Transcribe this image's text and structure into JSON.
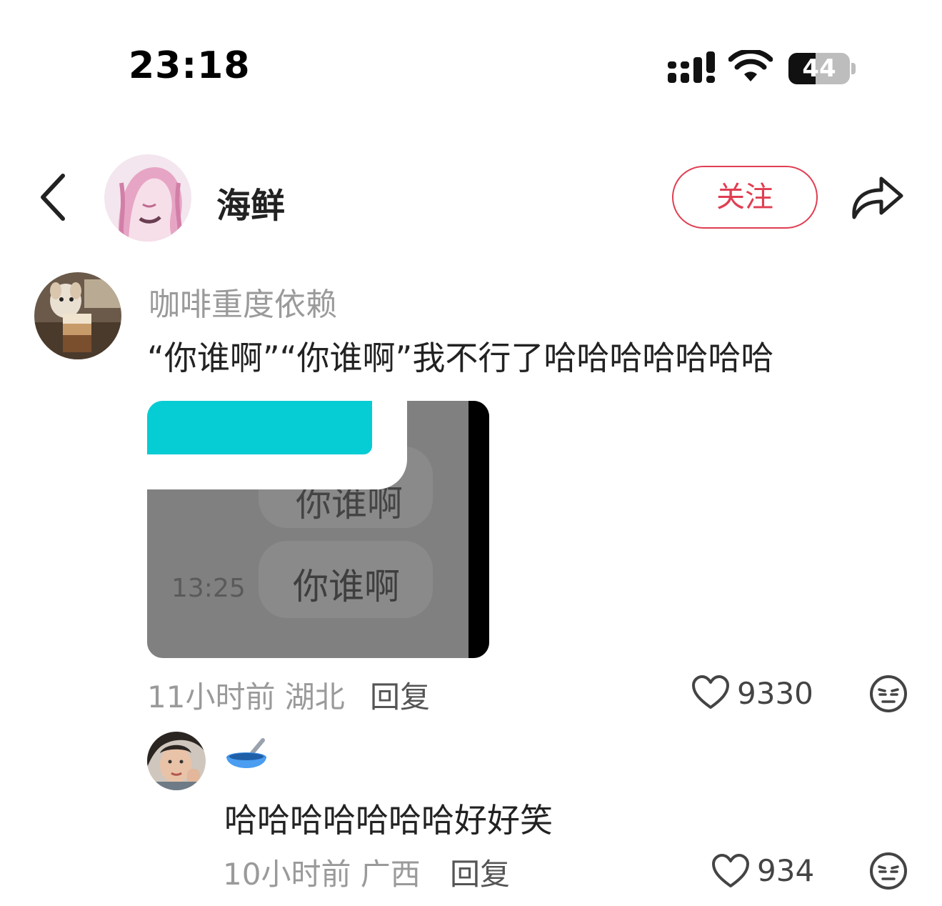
{
  "status_bar": {
    "time": "23:18",
    "battery_level": "44",
    "battery_percent": 44,
    "icons": [
      "signal-icon",
      "wifi-icon",
      "battery-icon"
    ]
  },
  "header": {
    "back_icon": "chevron-left-icon",
    "author_name": "海鲜",
    "follow_label": "关注",
    "share_icon": "share-arrow-icon",
    "accent_color": "#e03e52"
  },
  "comment": {
    "username": "咖啡重度依赖",
    "text": "“你谁啊”“你谁啊”我不行了哈哈哈哈哈哈哈",
    "image": {
      "bubble_top_text": "你谁啊",
      "bubble_text": "你谁啊",
      "time": "13:25",
      "teal_color": "#06ccd4"
    },
    "meta_time": "11小时前 湖北",
    "reply_label": "回复",
    "like_count": "9330"
  },
  "reply": {
    "user_icon": "bowl-spoon-emoji-icon",
    "text": "哈哈哈哈哈哈哈好好笑",
    "meta_time": "10小时前 广西",
    "reply_label": "回复",
    "like_count": "934"
  }
}
